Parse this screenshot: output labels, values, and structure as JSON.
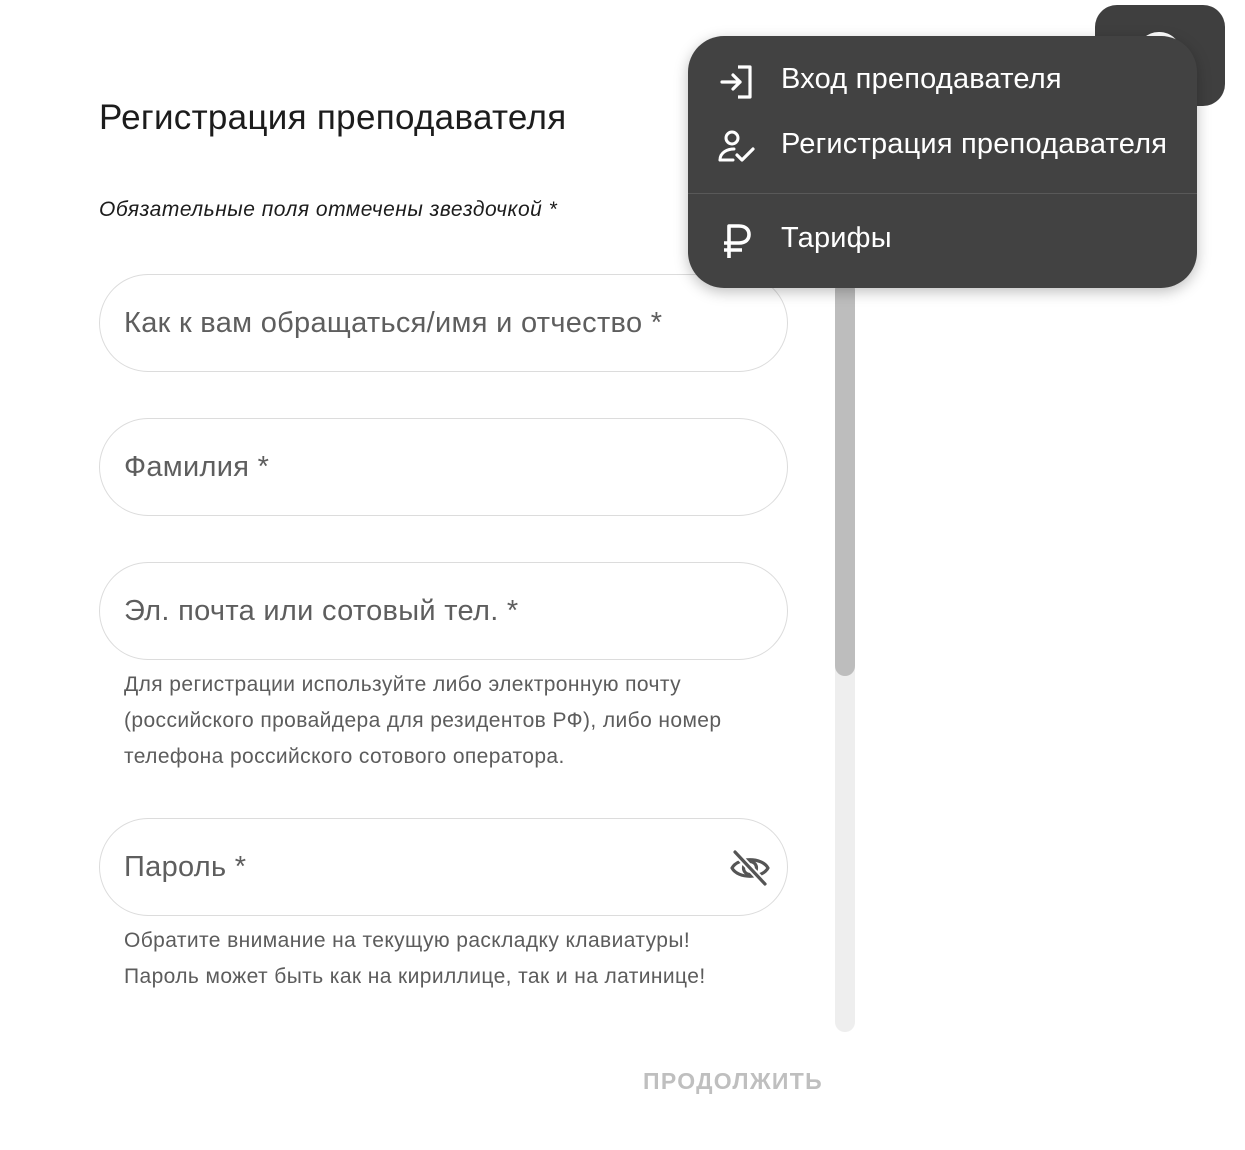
{
  "form": {
    "title": "Регистрация преподавателя",
    "required_note": "Обязательные поля отмечены звездочкой *",
    "name_field": {
      "placeholder": "Как к вам обращаться/имя и отчество *",
      "value": ""
    },
    "surname_field": {
      "placeholder": "Фамилия *",
      "value": ""
    },
    "contact_field": {
      "placeholder": "Эл. почта или сотовый тел. *",
      "value": "",
      "helper": "Для регистрации используйте либо электронную почту (российского провайдера для резидентов РФ), либо номер телефона российского сотового оператора."
    },
    "password_field": {
      "placeholder": "Пароль *",
      "value": "",
      "helper_line1": "Обратите внимание на текущую раскладку клавиатуры!",
      "helper_line2": "Пароль может быть как на кириллице, так и на латинице!",
      "toggle_icon": "eye-off-icon"
    },
    "continue_label": "ПРОДОЛЖИТЬ",
    "continue_enabled": false
  },
  "account": {
    "icon": "account-circle-icon"
  },
  "menu": {
    "items": [
      {
        "icon": "login-icon",
        "label": "Вход преподавателя"
      },
      {
        "icon": "person-check-icon",
        "label": "Регистрация преподавателя"
      },
      {
        "icon": "ruble-icon",
        "label": "Тарифы"
      }
    ]
  },
  "colors": {
    "menu_background": "#424242",
    "menu_text": "#ffffff",
    "placeholder_text": "#5e5e5e",
    "field_border": "#dcdcdc",
    "disabled_button_text": "#bfbfbf",
    "scroll_thumb": "#bdbdbd",
    "scroll_track": "#eeeeee"
  }
}
